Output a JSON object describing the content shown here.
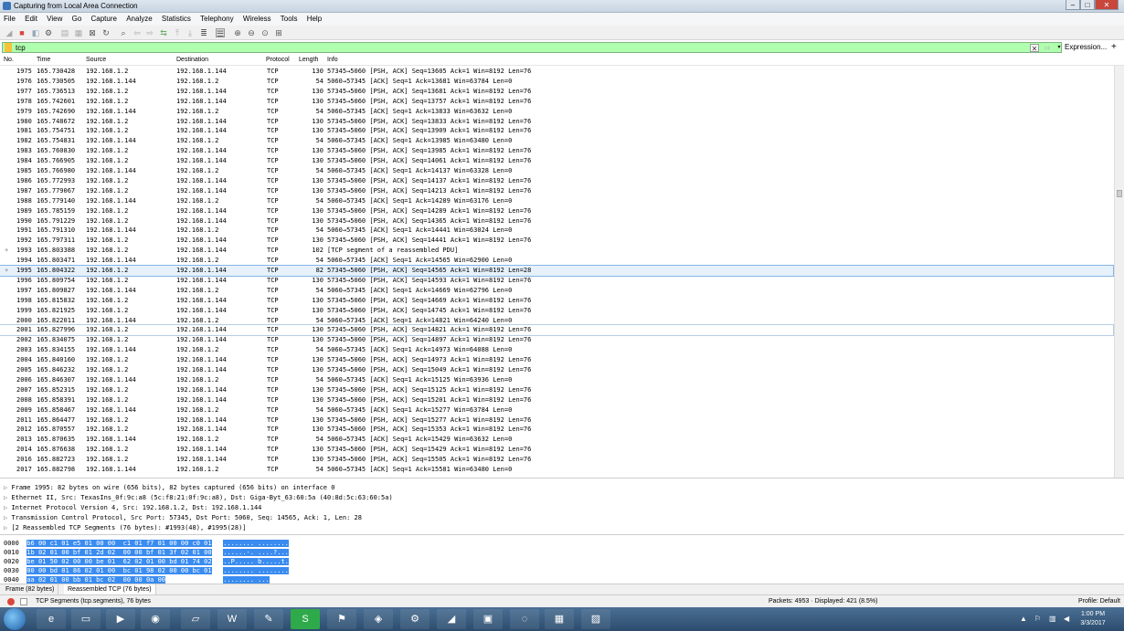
{
  "window": {
    "title": "Capturing from Local Area Connection",
    "minimize": "–",
    "maximize": "□",
    "close": "✕"
  },
  "menu": [
    "File",
    "Edit",
    "View",
    "Go",
    "Capture",
    "Analyze",
    "Statistics",
    "Telephony",
    "Wireless",
    "Tools",
    "Help"
  ],
  "filter": {
    "value": "tcp",
    "expression_label": "Expression...",
    "plus_label": "+",
    "clear_label": "✕",
    "apply_label": "⇨",
    "dropdown_label": "▾",
    "color": "#afffaf"
  },
  "columns": [
    "No.",
    "Time",
    "Source",
    "Destination",
    "Protocol",
    "Length",
    "Info"
  ],
  "packets": [
    {
      "no": "1975",
      "time": "165.730428",
      "src": "192.168.1.2",
      "dst": "192.168.1.144",
      "proto": "TCP",
      "len": "130",
      "info": "57345→5060 [PSH, ACK] Seq=13605 Ack=1 Win=8192 Len=76"
    },
    {
      "no": "1976",
      "time": "165.730505",
      "src": "192.168.1.144",
      "dst": "192.168.1.2",
      "proto": "TCP",
      "len": "54",
      "info": "5060→57345 [ACK] Seq=1 Ack=13681 Win=63784 Len=0"
    },
    {
      "no": "1977",
      "time": "165.736513",
      "src": "192.168.1.2",
      "dst": "192.168.1.144",
      "proto": "TCP",
      "len": "130",
      "info": "57345→5060 [PSH, ACK] Seq=13681 Ack=1 Win=8192 Len=76"
    },
    {
      "no": "1978",
      "time": "165.742601",
      "src": "192.168.1.2",
      "dst": "192.168.1.144",
      "proto": "TCP",
      "len": "130",
      "info": "57345→5060 [PSH, ACK] Seq=13757 Ack=1 Win=8192 Len=76"
    },
    {
      "no": "1979",
      "time": "165.742690",
      "src": "192.168.1.144",
      "dst": "192.168.1.2",
      "proto": "TCP",
      "len": "54",
      "info": "5060→57345 [ACK] Seq=1 Ack=13833 Win=63632 Len=0"
    },
    {
      "no": "1980",
      "time": "165.748672",
      "src": "192.168.1.2",
      "dst": "192.168.1.144",
      "proto": "TCP",
      "len": "130",
      "info": "57345→5060 [PSH, ACK] Seq=13833 Ack=1 Win=8192 Len=76"
    },
    {
      "no": "1981",
      "time": "165.754751",
      "src": "192.168.1.2",
      "dst": "192.168.1.144",
      "proto": "TCP",
      "len": "130",
      "info": "57345→5060 [PSH, ACK] Seq=13909 Ack=1 Win=8192 Len=76"
    },
    {
      "no": "1982",
      "time": "165.754831",
      "src": "192.168.1.144",
      "dst": "192.168.1.2",
      "proto": "TCP",
      "len": "54",
      "info": "5060→57345 [ACK] Seq=1 Ack=13985 Win=63480 Len=0"
    },
    {
      "no": "1983",
      "time": "165.760830",
      "src": "192.168.1.2",
      "dst": "192.168.1.144",
      "proto": "TCP",
      "len": "130",
      "info": "57345→5060 [PSH, ACK] Seq=13985 Ack=1 Win=8192 Len=76"
    },
    {
      "no": "1984",
      "time": "165.766905",
      "src": "192.168.1.2",
      "dst": "192.168.1.144",
      "proto": "TCP",
      "len": "130",
      "info": "57345→5060 [PSH, ACK] Seq=14061 Ack=1 Win=8192 Len=76"
    },
    {
      "no": "1985",
      "time": "165.766980",
      "src": "192.168.1.144",
      "dst": "192.168.1.2",
      "proto": "TCP",
      "len": "54",
      "info": "5060→57345 [ACK] Seq=1 Ack=14137 Win=63328 Len=0"
    },
    {
      "no": "1986",
      "time": "165.772993",
      "src": "192.168.1.2",
      "dst": "192.168.1.144",
      "proto": "TCP",
      "len": "130",
      "info": "57345→5060 [PSH, ACK] Seq=14137 Ack=1 Win=8192 Len=76"
    },
    {
      "no": "1987",
      "time": "165.779067",
      "src": "192.168.1.2",
      "dst": "192.168.1.144",
      "proto": "TCP",
      "len": "130",
      "info": "57345→5060 [PSH, ACK] Seq=14213 Ack=1 Win=8192 Len=76"
    },
    {
      "no": "1988",
      "time": "165.779140",
      "src": "192.168.1.144",
      "dst": "192.168.1.2",
      "proto": "TCP",
      "len": "54",
      "info": "5060→57345 [ACK] Seq=1 Ack=14289 Win=63176 Len=0"
    },
    {
      "no": "1989",
      "time": "165.785159",
      "src": "192.168.1.2",
      "dst": "192.168.1.144",
      "proto": "TCP",
      "len": "130",
      "info": "57345→5060 [PSH, ACK] Seq=14289 Ack=1 Win=8192 Len=76"
    },
    {
      "no": "1990",
      "time": "165.791229",
      "src": "192.168.1.2",
      "dst": "192.168.1.144",
      "proto": "TCP",
      "len": "130",
      "info": "57345→5060 [PSH, ACK] Seq=14365 Ack=1 Win=8192 Len=76"
    },
    {
      "no": "1991",
      "time": "165.791310",
      "src": "192.168.1.144",
      "dst": "192.168.1.2",
      "proto": "TCP",
      "len": "54",
      "info": "5060→57345 [ACK] Seq=1 Ack=14441 Win=63024 Len=0"
    },
    {
      "no": "1992",
      "time": "165.797311",
      "src": "192.168.1.2",
      "dst": "192.168.1.144",
      "proto": "TCP",
      "len": "130",
      "info": "57345→5060 [PSH, ACK] Seq=14441 Ack=1 Win=8192 Len=76"
    },
    {
      "no": "1993",
      "time": "165.803388",
      "src": "192.168.1.2",
      "dst": "192.168.1.144",
      "proto": "TCP",
      "len": "102",
      "info": "[TCP segment of a reassembled PDU]"
    },
    {
      "no": "1994",
      "time": "165.803471",
      "src": "192.168.1.144",
      "dst": "192.168.1.2",
      "proto": "TCP",
      "len": "54",
      "info": "5060→57345 [ACK] Seq=1 Ack=14565 Win=62900 Len=0"
    },
    {
      "no": "1995",
      "time": "165.804322",
      "src": "192.168.1.2",
      "dst": "192.168.1.144",
      "proto": "TCP",
      "len": "82",
      "info": "57345→5060 [PSH, ACK] Seq=14565 Ack=1 Win=8192 Len=28"
    },
    {
      "no": "1996",
      "time": "165.809754",
      "src": "192.168.1.2",
      "dst": "192.168.1.144",
      "proto": "TCP",
      "len": "130",
      "info": "57345→5060 [PSH, ACK] Seq=14593 Ack=1 Win=8192 Len=76"
    },
    {
      "no": "1997",
      "time": "165.809827",
      "src": "192.168.1.144",
      "dst": "192.168.1.2",
      "proto": "TCP",
      "len": "54",
      "info": "5060→57345 [ACK] Seq=1 Ack=14669 Win=62796 Len=0"
    },
    {
      "no": "1998",
      "time": "165.815832",
      "src": "192.168.1.2",
      "dst": "192.168.1.144",
      "proto": "TCP",
      "len": "130",
      "info": "57345→5060 [PSH, ACK] Seq=14669 Ack=1 Win=8192 Len=76"
    },
    {
      "no": "1999",
      "time": "165.821925",
      "src": "192.168.1.2",
      "dst": "192.168.1.144",
      "proto": "TCP",
      "len": "130",
      "info": "57345→5060 [PSH, ACK] Seq=14745 Ack=1 Win=8192 Len=76"
    },
    {
      "no": "2000",
      "time": "165.822011",
      "src": "192.168.1.144",
      "dst": "192.168.1.2",
      "proto": "TCP",
      "len": "54",
      "info": "5060→57345 [ACK] Seq=1 Ack=14821 Win=64240 Len=0"
    },
    {
      "no": "2001",
      "time": "165.827996",
      "src": "192.168.1.2",
      "dst": "192.168.1.144",
      "proto": "TCP",
      "len": "130",
      "info": "57345→5060 [PSH, ACK] Seq=14821 Ack=1 Win=8192 Len=76"
    },
    {
      "no": "2002",
      "time": "165.834075",
      "src": "192.168.1.2",
      "dst": "192.168.1.144",
      "proto": "TCP",
      "len": "130",
      "info": "57345→5060 [PSH, ACK] Seq=14897 Ack=1 Win=8192 Len=76"
    },
    {
      "no": "2003",
      "time": "165.834155",
      "src": "192.168.1.144",
      "dst": "192.168.1.2",
      "proto": "TCP",
      "len": "54",
      "info": "5060→57345 [ACK] Seq=1 Ack=14973 Win=64088 Len=0"
    },
    {
      "no": "2004",
      "time": "165.840160",
      "src": "192.168.1.2",
      "dst": "192.168.1.144",
      "proto": "TCP",
      "len": "130",
      "info": "57345→5060 [PSH, ACK] Seq=14973 Ack=1 Win=8192 Len=76"
    },
    {
      "no": "2005",
      "time": "165.846232",
      "src": "192.168.1.2",
      "dst": "192.168.1.144",
      "proto": "TCP",
      "len": "130",
      "info": "57345→5060 [PSH, ACK] Seq=15049 Ack=1 Win=8192 Len=76"
    },
    {
      "no": "2006",
      "time": "165.846307",
      "src": "192.168.1.144",
      "dst": "192.168.1.2",
      "proto": "TCP",
      "len": "54",
      "info": "5060→57345 [ACK] Seq=1 Ack=15125 Win=63936 Len=0"
    },
    {
      "no": "2007",
      "time": "165.852315",
      "src": "192.168.1.2",
      "dst": "192.168.1.144",
      "proto": "TCP",
      "len": "130",
      "info": "57345→5060 [PSH, ACK] Seq=15125 Ack=1 Win=8192 Len=76"
    },
    {
      "no": "2008",
      "time": "165.858391",
      "src": "192.168.1.2",
      "dst": "192.168.1.144",
      "proto": "TCP",
      "len": "130",
      "info": "57345→5060 [PSH, ACK] Seq=15201 Ack=1 Win=8192 Len=76"
    },
    {
      "no": "2009",
      "time": "165.858467",
      "src": "192.168.1.144",
      "dst": "192.168.1.2",
      "proto": "TCP",
      "len": "54",
      "info": "5060→57345 [ACK] Seq=1 Ack=15277 Win=63784 Len=0"
    },
    {
      "no": "2011",
      "time": "165.864477",
      "src": "192.168.1.2",
      "dst": "192.168.1.144",
      "proto": "TCP",
      "len": "130",
      "info": "57345→5060 [PSH, ACK] Seq=15277 Ack=1 Win=8192 Len=76"
    },
    {
      "no": "2012",
      "time": "165.870557",
      "src": "192.168.1.2",
      "dst": "192.168.1.144",
      "proto": "TCP",
      "len": "130",
      "info": "57345→5060 [PSH, ACK] Seq=15353 Ack=1 Win=8192 Len=76"
    },
    {
      "no": "2013",
      "time": "165.870635",
      "src": "192.168.1.144",
      "dst": "192.168.1.2",
      "proto": "TCP",
      "len": "54",
      "info": "5060→57345 [ACK] Seq=1 Ack=15429 Win=63632 Len=0"
    },
    {
      "no": "2014",
      "time": "165.876638",
      "src": "192.168.1.2",
      "dst": "192.168.1.144",
      "proto": "TCP",
      "len": "130",
      "info": "57345→5060 [PSH, ACK] Seq=15429 Ack=1 Win=8192 Len=76"
    },
    {
      "no": "2016",
      "time": "165.882723",
      "src": "192.168.1.2",
      "dst": "192.168.1.144",
      "proto": "TCP",
      "len": "130",
      "info": "57345→5060 [PSH, ACK] Seq=15505 Ack=1 Win=8192 Len=76"
    },
    {
      "no": "2017",
      "time": "165.882798",
      "src": "192.168.1.144",
      "dst": "192.168.1.2",
      "proto": "TCP",
      "len": "54",
      "info": "5060→57345 [ACK] Seq=1 Ack=15581 Win=63480 Len=0"
    }
  ],
  "selected_packet": "1995",
  "details": [
    "Frame 1995: 82 bytes on wire (656 bits), 82 bytes captured (656 bits) on interface 0",
    "Ethernet II, Src: TexasIns_0f:9c:a8 (5c:f8:21:0f:9c:a8), Dst: Giga-Byt_63:60:5a (40:8d:5c:63:60:5a)",
    "Internet Protocol Version 4, Src: 192.168.1.2, Dst: 192.168.1.144",
    "Transmission Control Protocol, Src Port: 57345, Dst Port: 5060, Seq: 14565, Ack: 1, Len: 28",
    "[2 Reassembled TCP Segments (76 bytes): #1993(48), #1995(28)]"
  ],
  "hex_rows": [
    {
      "offset": "0000",
      "hex": "b6 00 c1 01 e5 01 00 00  c1 01 f7 01 00 00 c0 01",
      "ascii": "........ ........"
    },
    {
      "offset": "0010",
      "hex": "1b 02 01 00 bf 01 2d 02  00 00 bf 01 3f 02 01 00",
      "ascii": "......-. ....?..."
    },
    {
      "offset": "0020",
      "hex": "be 01 50 02 00 00 be 01  62 02 01 00 bd 01 74 02",
      "ascii": "..P..... b.....t."
    },
    {
      "offset": "0030",
      "hex": "00 00 bd 01 86 02 01 00  bc 01 98 02 00 00 bc 01",
      "ascii": "........ ........"
    },
    {
      "offset": "0040",
      "hex": "aa 02 01 00 bb 01 bc 02  00 00 0a 00",
      "ascii": "........ ..."
    }
  ],
  "byte_tabs": [
    "Frame (82 bytes)",
    "Reassembled TCP (76 bytes)"
  ],
  "status": {
    "field": "TCP Segments (tcp.segments), 76 bytes",
    "packets": "Packets: 4953 · Displayed: 421 (8.5%)",
    "profile": "Profile: Default"
  },
  "taskbar": {
    "time": "1:00 PM",
    "date": "3/3/2017"
  }
}
